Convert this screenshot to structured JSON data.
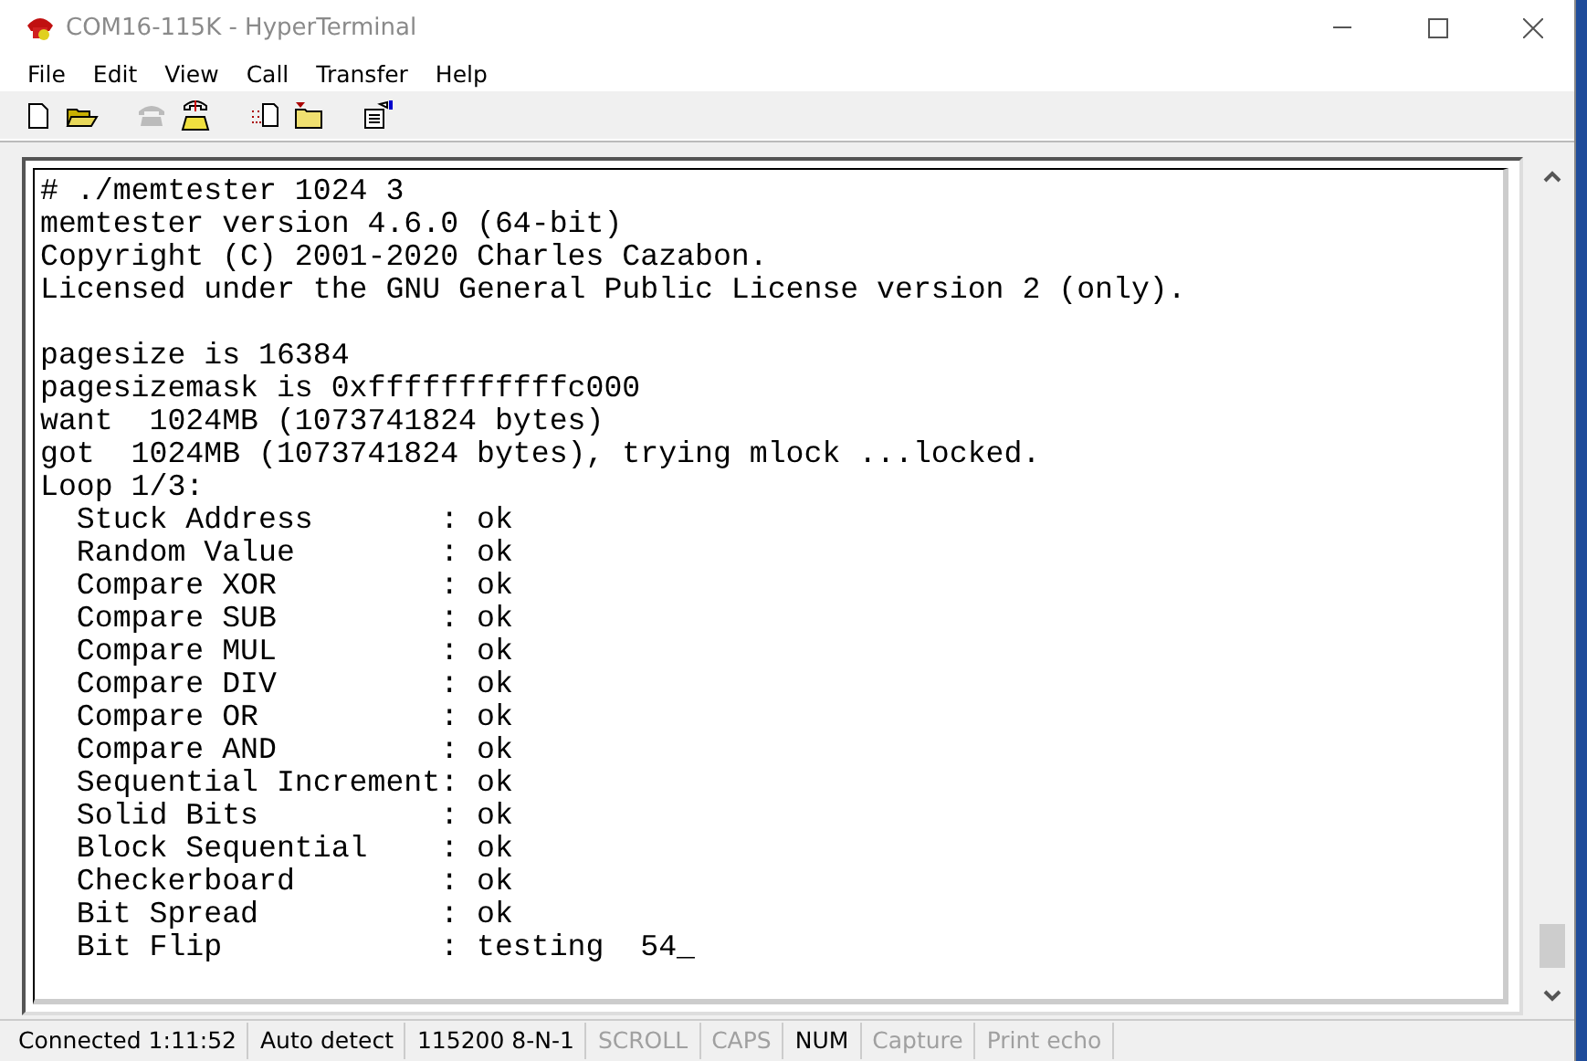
{
  "window": {
    "title": "COM16-115K - HyperTerminal",
    "active": false
  },
  "menu": [
    "File",
    "Edit",
    "View",
    "Call",
    "Transfer",
    "Help"
  ],
  "toolbar": [
    {
      "kind": "new",
      "disabled": false
    },
    {
      "kind": "open",
      "disabled": false
    },
    {
      "kind": "sep"
    },
    {
      "kind": "phone",
      "disabled": true
    },
    {
      "kind": "call",
      "disabled": false
    },
    {
      "kind": "sep"
    },
    {
      "kind": "send",
      "disabled": false
    },
    {
      "kind": "receive",
      "disabled": false
    },
    {
      "kind": "sep"
    },
    {
      "kind": "properties",
      "disabled": false
    }
  ],
  "terminal": {
    "blocks": [
      [
        "# ./memtester 1024 3",
        "memtester version 4.6.0 (64-bit)",
        "Copyright (C) 2001-2020 Charles Cazabon.",
        "Licensed under the GNU General Public License version 2 (only)."
      ],
      [
        "pagesize is 16384",
        "pagesizemask is 0xfffffffffffc000",
        "want  1024MB (1073741824 bytes)",
        "got  1024MB (1073741824 bytes), trying mlock ...locked.",
        "Loop 1/3:",
        "  Stuck Address       : ok",
        "  Random Value        : ok",
        "  Compare XOR         : ok",
        "  Compare SUB         : ok",
        "  Compare MUL         : ok",
        "  Compare DIV         : ok",
        "  Compare OR          : ok",
        "  Compare AND         : ok",
        "  Sequential Increment: ok",
        "  Solid Bits          : ok",
        "  Block Sequential    : ok",
        "  Checkerboard        : ok",
        "  Bit Spread          : ok",
        "  Bit Flip            : testing  54_"
      ]
    ]
  },
  "status_bar": [
    {
      "text": "Connected 1:11:52",
      "disabled": false
    },
    {
      "text": "Auto detect",
      "disabled": false
    },
    {
      "text": "115200 8-N-1",
      "disabled": false
    },
    {
      "text": "SCROLL",
      "disabled": true
    },
    {
      "text": "CAPS",
      "disabled": true
    },
    {
      "text": "NUM",
      "disabled": false
    },
    {
      "text": "Capture",
      "disabled": true
    },
    {
      "text": "Print echo",
      "disabled": true
    }
  ]
}
